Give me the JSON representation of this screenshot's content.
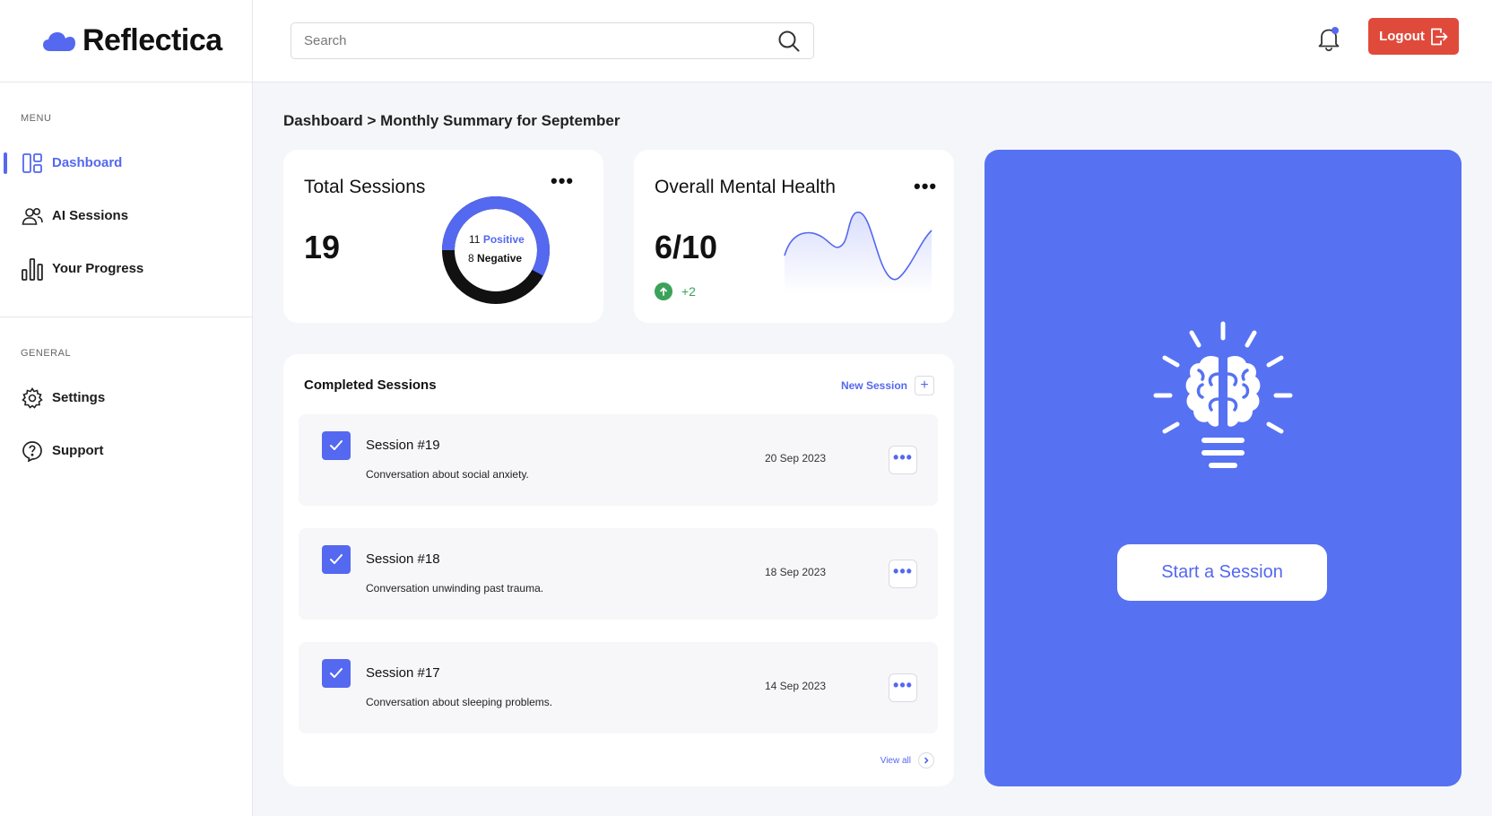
{
  "app": {
    "name": "Reflectica"
  },
  "search": {
    "placeholder": "Search"
  },
  "header": {
    "logout_label": "Logout"
  },
  "sidebar": {
    "menu_label": "MENU",
    "items": [
      {
        "label": "Dashboard",
        "icon": "dashboard-icon",
        "active": true
      },
      {
        "label": "AI Sessions",
        "icon": "users-icon"
      },
      {
        "label": "Your Progress",
        "icon": "bar-chart-icon"
      }
    ],
    "general_label": "GENERAL",
    "general_items": [
      {
        "label": "Settings",
        "icon": "gear-icon"
      },
      {
        "label": "Support",
        "icon": "help-icon"
      }
    ]
  },
  "breadcrumb": "Dashboard > Monthly Summary for September",
  "total_sessions": {
    "title": "Total Sessions",
    "value": "19",
    "positive_count": "11",
    "positive_label": "Positive",
    "negative_count": "8",
    "negative_label": "Negative"
  },
  "mental_health": {
    "title": "Overall Mental Health",
    "value": "6/10",
    "change": "+2"
  },
  "completed_sessions": {
    "title": "Completed Sessions",
    "new_session_label": "New Session",
    "view_all_label": "View all",
    "rows": [
      {
        "name": "Session #19",
        "description": "Conversation about social anxiety.",
        "date": "20 Sep 2023"
      },
      {
        "name": "Session #18",
        "description": "Conversation unwinding past trauma.",
        "date": "18 Sep 2023"
      },
      {
        "name": "Session #17",
        "description": "Conversation about sleeping problems.",
        "date": "14 Sep 2023"
      }
    ]
  },
  "promo": {
    "button_label": "Start a Session"
  },
  "colors": {
    "accent": "#5468f0",
    "promo_bg": "#5672f2",
    "logout": "#e04a3b",
    "positive_trend": "#3aa25a"
  }
}
